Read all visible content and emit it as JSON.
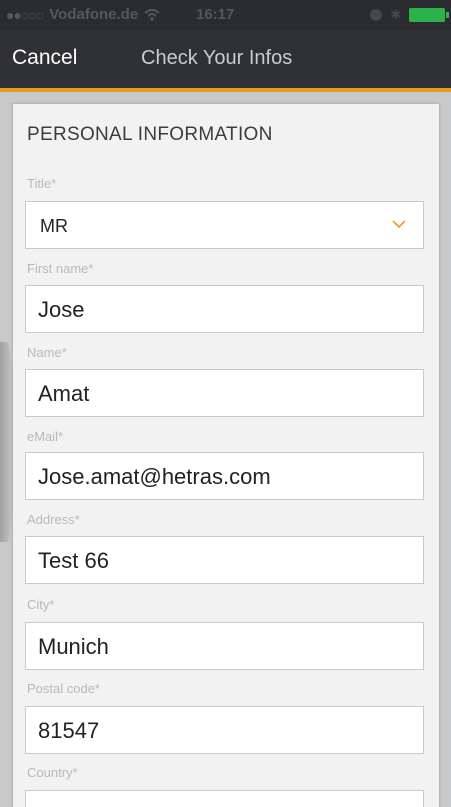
{
  "status_bar": {
    "signal": "●●○○○",
    "carrier": "Vodafone.de",
    "time": "16:17"
  },
  "nav": {
    "cancel_label": "Cancel",
    "title": "Check Your Infos"
  },
  "colors": {
    "accent": "#e99d1f",
    "battery": "#2db24a"
  },
  "form": {
    "section_title": "PERSONAL INFORMATION",
    "title": {
      "label": "Title*",
      "value": "MR"
    },
    "first_name": {
      "label": "First name*",
      "value": "Jose"
    },
    "name": {
      "label": "Name*",
      "value": "Amat"
    },
    "email": {
      "label": "eMail*",
      "value": "Jose.amat@hetras.com"
    },
    "address": {
      "label": "Address*",
      "value": "Test 66"
    },
    "city": {
      "label": "City*",
      "value": "Munich"
    },
    "postal_code": {
      "label": "Postal code*",
      "value": "81547"
    },
    "country": {
      "label": "Country*",
      "value": ""
    }
  }
}
